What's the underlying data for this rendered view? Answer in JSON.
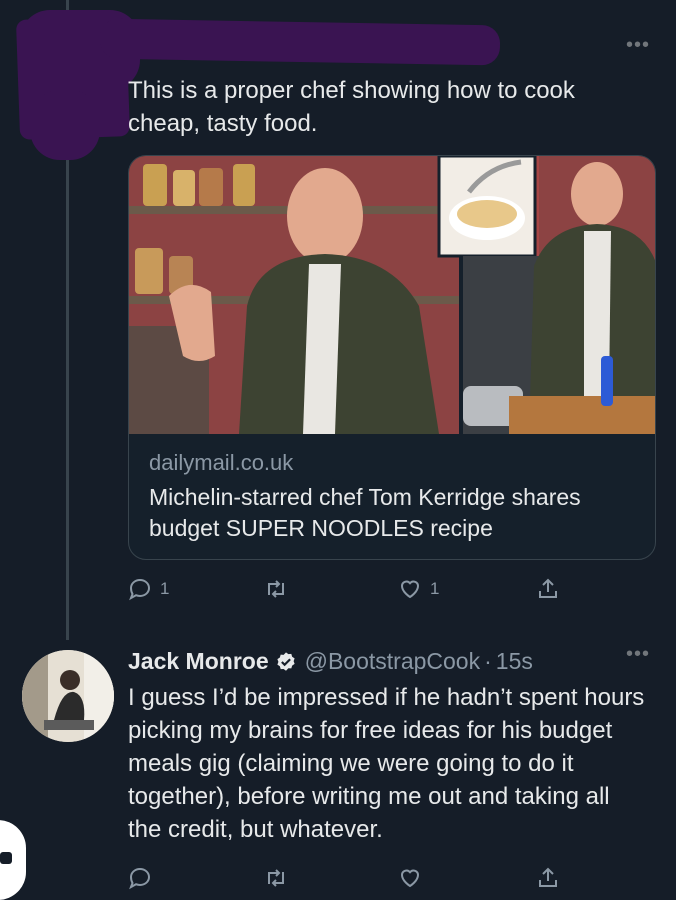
{
  "tweet1": {
    "text": "This is a proper chef showing how to cook cheap, tasty food.",
    "more": "•••",
    "card": {
      "domain": "dailymail.co.uk",
      "title": "Michelin-starred chef Tom Kerridge shares budget SUPER NOODLES recipe"
    },
    "actions": {
      "reply_count": "1",
      "retweet_count": "",
      "like_count": "1"
    }
  },
  "tweet2": {
    "name": "Jack Monroe",
    "handle": "@BootstrapCook",
    "separator": "·",
    "time": "15s",
    "more": "•••",
    "text": "I guess I’d be impressed if he hadn’t spent hours picking my brains for free ideas for his budget meals gig (claiming we were going to do it together), before writing me out and taking all the credit, but whatever.",
    "actions": {
      "reply_count": "",
      "retweet_count": "",
      "like_count": ""
    }
  },
  "colors": {
    "background": "#151d28",
    "muted": "#8b98a5",
    "verified": "#e7e9ea",
    "redaction": "#3a1452"
  },
  "icons": [
    "reply-icon",
    "retweet-icon",
    "like-icon",
    "share-icon",
    "verified-icon",
    "more-icon"
  ]
}
